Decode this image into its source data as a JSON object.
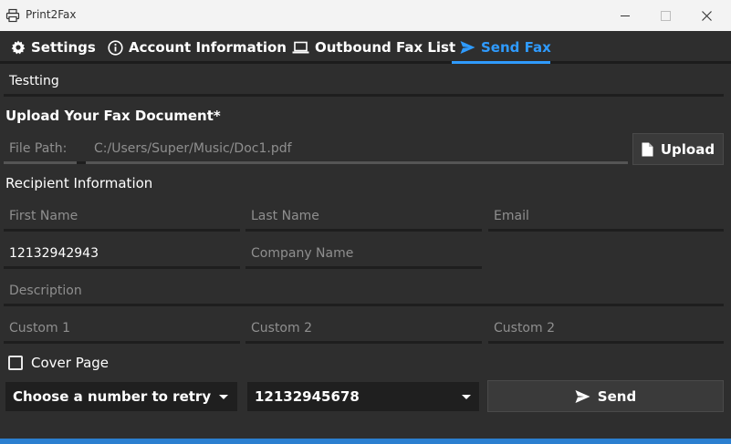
{
  "window": {
    "title": "Print2Fax"
  },
  "tabs": [
    {
      "label": "Settings",
      "icon": "gear-icon"
    },
    {
      "label": "Account Information",
      "icon": "info-icon"
    },
    {
      "label": "Outbound Fax List",
      "icon": "laptop-icon"
    },
    {
      "label": "Send Fax",
      "icon": "send-icon",
      "active": true
    }
  ],
  "form": {
    "subject_value": "Testting",
    "upload_heading": "Upload Your Fax Document*",
    "file_path_label": "File Path:",
    "file_path_value": "C:/Users/Super/Music/Doc1.pdf",
    "upload_button": "Upload",
    "recipient_heading": "Recipient Information",
    "first_name_placeholder": "First Name",
    "last_name_placeholder": "Last Name",
    "email_placeholder": "Email",
    "fax_number_value": "12132942943",
    "company_placeholder": "Company Name",
    "description_placeholder": "Description",
    "custom1_placeholder": "Custom 1",
    "custom2_placeholder": "Custom 2",
    "custom3_placeholder": "Custom 2",
    "cover_page_label": "Cover Page",
    "cover_page_checked": false,
    "retry_dropdown": "Choose a number to retry",
    "from_number_dropdown": "12132945678",
    "send_button": "Send"
  },
  "colors": {
    "accent": "#2f9bff",
    "background": "#2e2e2e",
    "titlebar": "#f3f3f3"
  }
}
